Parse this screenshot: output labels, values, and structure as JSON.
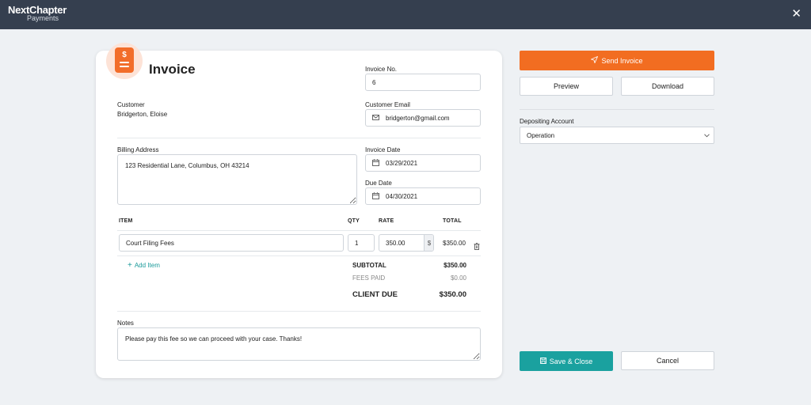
{
  "header": {
    "logo_main": "NextChapter",
    "logo_sub": "Payments",
    "close_glyph": "✕"
  },
  "invoice": {
    "title": "Invoice",
    "invoice_no_label": "Invoice No.",
    "invoice_no": "6",
    "customer_label": "Customer",
    "customer": "Bridgerton, Eloise",
    "email_label": "Customer Email",
    "email": "bridgerton@gmail.com",
    "billing_label": "Billing Address",
    "billing_address": "123 Residential Lane, Columbus, OH 43214",
    "invoice_date_label": "Invoice Date",
    "invoice_date": "03/29/2021",
    "due_date_label": "Due Date",
    "due_date": "04/30/2021"
  },
  "items": {
    "headers": {
      "item": "ITEM",
      "qty": "QTY",
      "rate": "RATE",
      "total": "TOTAL"
    },
    "rows": [
      {
        "item": "Court Filing Fees",
        "qty": "1",
        "rate": "350.00",
        "currency": "$",
        "total": "$350.00"
      }
    ],
    "add_item": "Add Item"
  },
  "summary": {
    "subtotal_label": "SUBTOTAL",
    "subtotal": "$350.00",
    "fees_paid_label": "FEES PAID",
    "fees_paid": "$0.00",
    "client_due_label": "CLIENT DUE",
    "client_due": "$350.00"
  },
  "notes": {
    "label": "Notes",
    "text": "Please pay this fee so we can proceed with your case. Thanks!"
  },
  "actions": {
    "send": "Send Invoice",
    "preview": "Preview",
    "download": "Download",
    "depositing_label": "Depositing Account",
    "depositing_value": "Operation",
    "save_close": "Save & Close",
    "cancel": "Cancel"
  },
  "colors": {
    "topbar": "#353f4f",
    "accent_orange": "#f26d21",
    "accent_teal": "#1aa19f",
    "page_bg": "#eef1f4"
  },
  "icons": [
    "receipt-icon",
    "mail-icon",
    "calendar-icon",
    "trash-icon",
    "plus-icon",
    "send-icon",
    "save-icon",
    "chevron-down-icon",
    "close-icon"
  ]
}
